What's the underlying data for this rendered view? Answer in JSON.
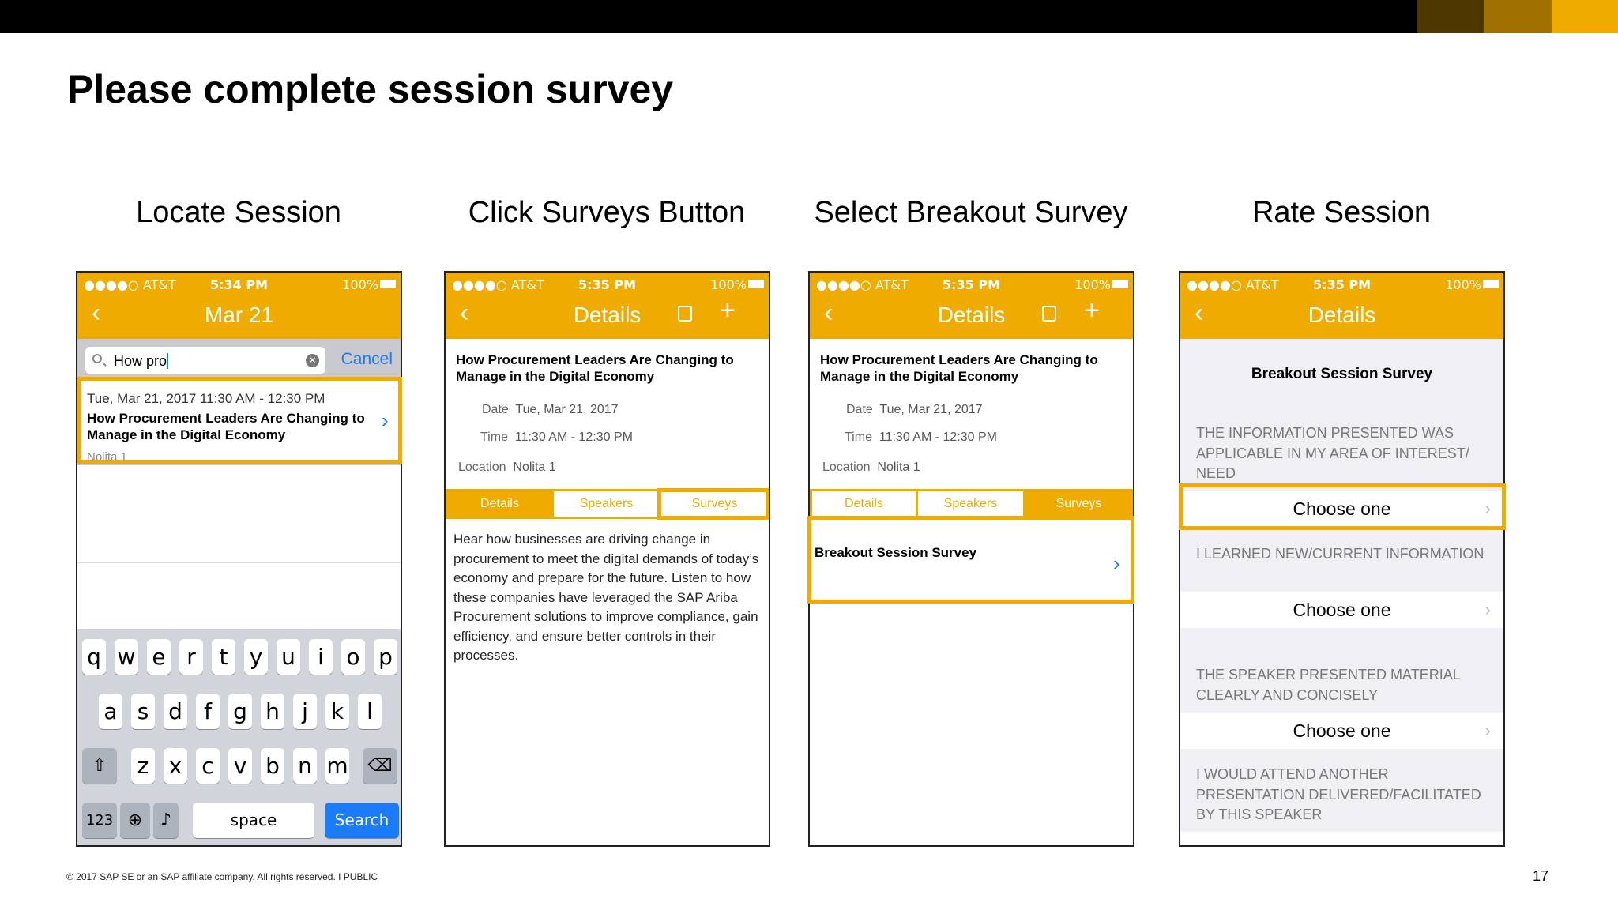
{
  "colors": {
    "accent": "#F0AB00",
    "ios_blue": "#1a7cf8",
    "topbar_swatches": [
      "#4d3600",
      "#a07000",
      "#F0AB00"
    ]
  },
  "slide": {
    "title": "Please complete session survey",
    "footer": "© 2017 SAP SE or an SAP affiliate company. All rights reserved. I   PUBLIC",
    "page_number": "17"
  },
  "steps": [
    "Locate Session",
    "Click Surveys Button",
    "Select Breakout Survey",
    "Rate Session"
  ],
  "status_bar": {
    "carrier": "●●●●○ AT&T",
    "battery": "100%",
    "time_1": "5:34 PM",
    "time_2": "5:35 PM"
  },
  "phone1": {
    "nav_title": "Mar 21",
    "search_query": "How pro",
    "cancel": "Cancel",
    "result": {
      "when": "Tue, Mar 21, 2017 11:30 AM - 12:30 PM",
      "title": "How Procurement Leaders Are Changing to Manage in the Digital Economy",
      "location": "Nolita 1"
    },
    "keyboard": {
      "row1": [
        "q",
        "w",
        "e",
        "r",
        "t",
        "y",
        "u",
        "i",
        "o",
        "p"
      ],
      "row2": [
        "a",
        "s",
        "d",
        "f",
        "g",
        "h",
        "j",
        "k",
        "l"
      ],
      "row3": [
        "z",
        "x",
        "c",
        "v",
        "b",
        "n",
        "m"
      ],
      "numbers": "123",
      "space": "space",
      "search": "Search"
    }
  },
  "details": {
    "nav_title": "Details",
    "event_title": "How Procurement Leaders Are Changing to Manage in the Digital Economy",
    "date_label": "Date",
    "date": "Tue, Mar 21, 2017",
    "time_label": "Time",
    "time": "11:30 AM - 12:30 PM",
    "location_label": "Location",
    "location": "Nolita 1",
    "tabs": [
      "Details",
      "Speakers",
      "Surveys"
    ],
    "description": "Hear how businesses are driving change in procurement to meet the digital demands of today’s economy and prepare for the future. Listen to how these companies have leveraged the SAP Ariba Procurement solutions to improve compliance, gain efficiency, and ensure better controls in their processes.",
    "survey_item": "Breakout Session Survey"
  },
  "phone4": {
    "nav_title": "Details",
    "heading": "Breakout Session Survey",
    "questions": [
      "THE INFORMATION PRESENTED WAS APPLICABLE IN MY AREA OF INTEREST/ NEED",
      "I LEARNED NEW/CURRENT INFORMATION",
      "THE SPEAKER PRESENTED MATERIAL CLEARLY AND CONCISELY",
      "I WOULD ATTEND ANOTHER PRESENTATION DELIVERED/FACILITATED BY THIS SPEAKER"
    ],
    "choose": "Choose one"
  }
}
